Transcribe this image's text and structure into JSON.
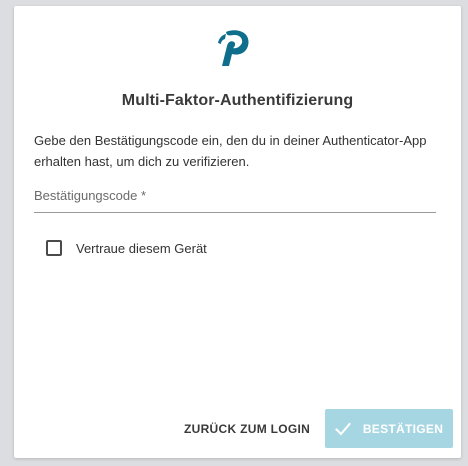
{
  "brand": {
    "accent": "#0e6e8c",
    "logo_icon": "p-logo-icon"
  },
  "title": "Multi-Faktor-Authentifizierung",
  "description": "Gebe den Bestätigungscode ein, den du in deiner Authenticator-App erhalten hast, um dich zu verifizieren.",
  "code_field": {
    "label": "Bestätigungscode *",
    "value": ""
  },
  "trust_device": {
    "label": "Vertraue diesem Gerät",
    "checked": false
  },
  "actions": {
    "back_label": "ZURÜCK ZUM LOGIN",
    "confirm_label": "BESTÄTIGEN",
    "confirm_color": "#a7d6e3",
    "confirm_icon": "check-icon"
  }
}
